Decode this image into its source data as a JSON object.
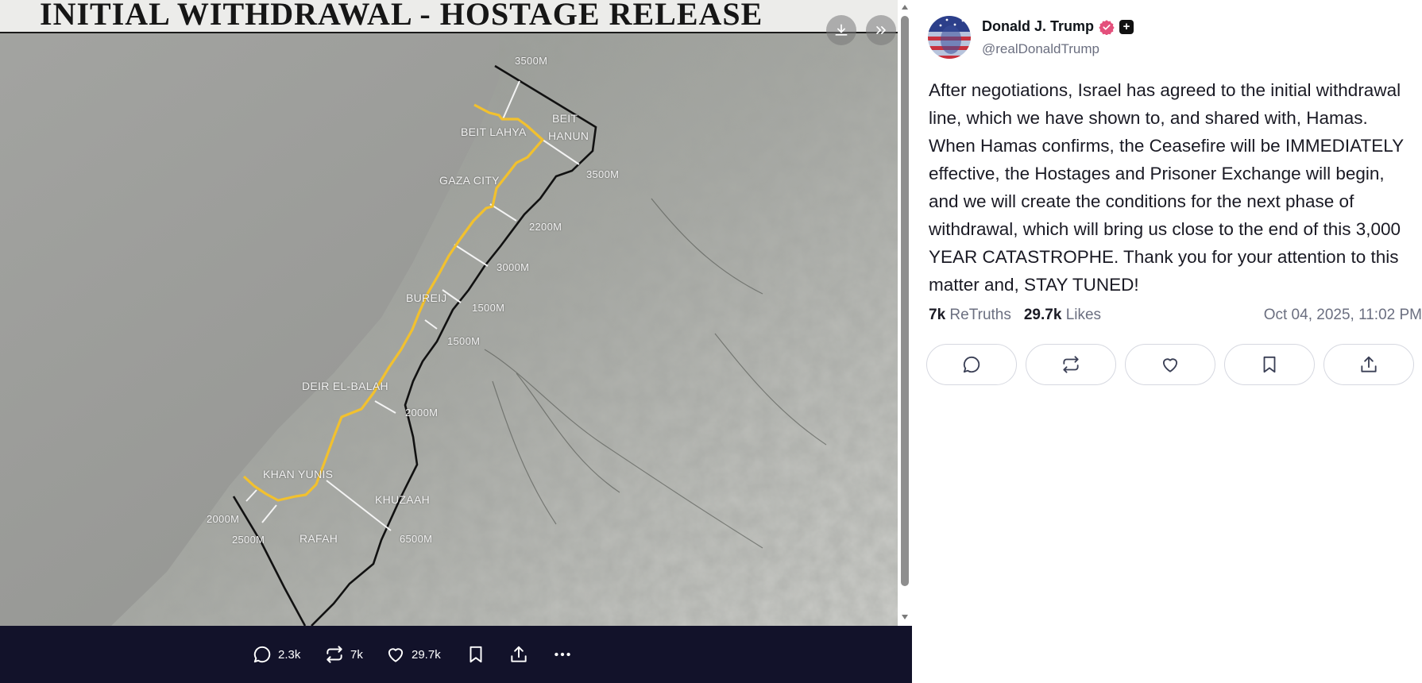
{
  "media": {
    "title": "INITIAL WITHDRAWAL - HOSTAGE RELEASE",
    "places": {
      "beit_lahya": "BEIT LAHYA",
      "beit": "BEIT",
      "hanun": "HANUN",
      "gaza_city": "GAZA CITY",
      "bureij": "BUREIJ",
      "deir_el_balah": "DEIR EL-BALAH",
      "khan_yunis": "KHAN YUNIS",
      "khuzaah": "KHUZAAH",
      "rafah": "RAFAH"
    },
    "distances": {
      "d1": "3500M",
      "d2": "3500M",
      "d3": "2200M",
      "d4": "3000M",
      "d5": "1500M",
      "d6": "1500M",
      "d7": "2000M",
      "d8": "2000M",
      "d9": "2500M",
      "d10": "6500M"
    },
    "download_icon": "download-icon",
    "expand_icon": "chevrons-right-icon",
    "line_color": "#f2c12e"
  },
  "media_bar": {
    "replies": "2.3k",
    "retruths": "7k",
    "likes": "29.7k",
    "background": "#12122a"
  },
  "post": {
    "display_name": "Donald J. Trump",
    "verified_color": "#e4507c",
    "handle": "@realDonaldTrump",
    "body": "After negotiations, Israel has agreed to the initial withdrawal line, which we have shown to, and shared with, Hamas. When Hamas confirms, the Ceasefire will be IMMEDIATELY effective, the Hostages and Prisoner Exchange will begin, and we will create the conditions for the next phase of withdrawal, which will bring us close to the end of this 3,000 YEAR CATASTROPHE. Thank you for your attention to this matter and, STAY TUNED!",
    "retruths_count": "7k",
    "retruths_label": "ReTruths",
    "likes_count": "29.7k",
    "likes_label": "Likes",
    "timestamp": "Oct 04, 2025, 11:02 PM",
    "actions": [
      "reply-icon",
      "retruth-icon",
      "heart-icon",
      "bookmark-icon",
      "share-icon"
    ]
  }
}
